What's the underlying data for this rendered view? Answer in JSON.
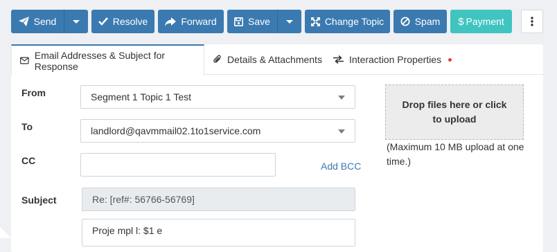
{
  "toolbar": {
    "send_label": "Send",
    "resolve_label": "Resolve",
    "forward_label": "Forward",
    "save_label": "Save",
    "change_topic_label": "Change Topic",
    "spam_label": "Spam",
    "payment_label": "Payment"
  },
  "colors": {
    "primary": "#3a7ab0",
    "payment": "#3fc4c0",
    "alert_dot": "#d9453b"
  },
  "tabs": [
    {
      "label": "Email Addresses & Subject for Response",
      "icon": "envelope-icon",
      "active": true
    },
    {
      "label": "Details & Attachments",
      "icon": "paperclip-icon",
      "active": false
    },
    {
      "label": "Interaction Properties",
      "icon": "swap-arrows-icon",
      "active": false,
      "indicator": true
    }
  ],
  "form": {
    "from_label": "From",
    "from_value": "Segment 1 Topic 1 Test",
    "to_label": "To",
    "to_value": "landlord@qavmmail02.1to1service.com",
    "cc_label": "CC",
    "cc_value": "",
    "add_bcc_label": "Add BCC",
    "subject_label": "Subject",
    "subject_value": "Re: [ref#: 56766-56769]",
    "body_preview": "Proje   mpl   l: $1   e"
  },
  "upload": {
    "dropzone_text": "Drop files here or click to upload",
    "note": "(Maximum 10 MB upload at one time.)"
  }
}
